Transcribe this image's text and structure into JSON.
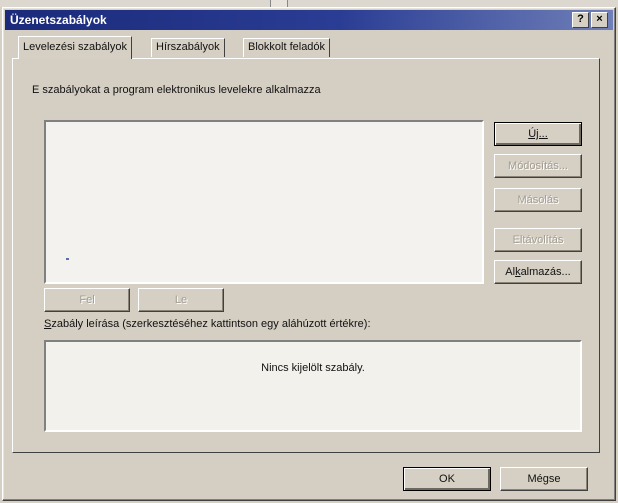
{
  "window": {
    "title": "Üzenetszabályok",
    "help_label": "?",
    "close_label": "×"
  },
  "tabs": [
    {
      "label": "Levelezési szabályok",
      "active": true
    },
    {
      "label": "Hírszabályok",
      "active": false
    },
    {
      "label": "Blokkolt feladók",
      "active": false
    }
  ],
  "panel": {
    "description": "E szabályokat a program elektronikus levelekre alkalmazza",
    "rule_list": []
  },
  "side_buttons": {
    "new": "Új...",
    "modify": "Módosítás...",
    "copy": "Másolás",
    "delete": "Eltávolítás",
    "apply_pre": "Al",
    "apply_key": "k",
    "apply_post": "almazás..."
  },
  "move_buttons": {
    "up": "Fel",
    "down": "Le"
  },
  "rule_desc": {
    "label_key": "S",
    "label_rest": "zabály leírása (szerkesztéséhez kattintson egy aláhúzott értékre):",
    "empty_text": "Nincs kijelölt szabály."
  },
  "footer": {
    "ok": "OK",
    "cancel": "Mégse"
  },
  "colors": {
    "title_bar": "#1b2a7a",
    "dialog_face": "#d6d0c4",
    "disabled_text": "#a39d92"
  }
}
